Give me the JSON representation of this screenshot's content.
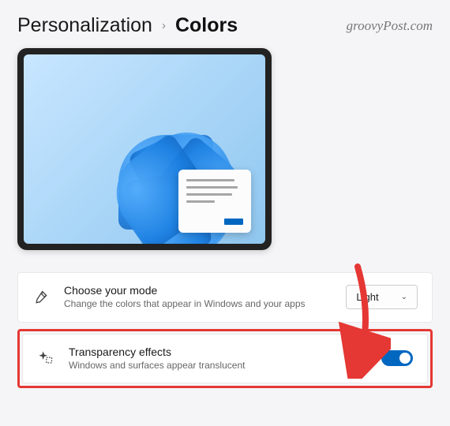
{
  "header": {
    "breadcrumb_parent": "Personalization",
    "breadcrumb_current": "Colors",
    "watermark": "groovyPost.com"
  },
  "rows": {
    "mode": {
      "title": "Choose your mode",
      "description": "Change the colors that appear in Windows and your apps",
      "selected_value": "Light"
    },
    "transparency": {
      "title": "Transparency effects",
      "description": "Windows and surfaces appear translucent",
      "state_label": "On",
      "enabled": true
    }
  },
  "colors": {
    "accent": "#0067c0",
    "highlight": "#e53733"
  }
}
